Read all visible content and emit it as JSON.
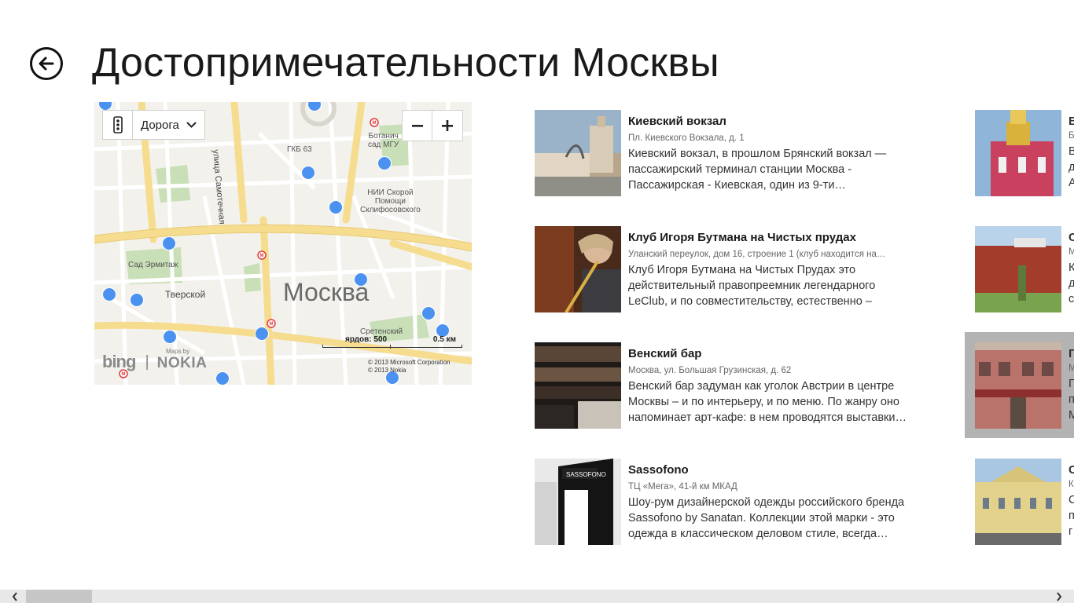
{
  "page": {
    "title": "Достопримечательности Москвы"
  },
  "map": {
    "style_label": "Дорога",
    "city_label": "Москва",
    "labels": {
      "samotechnaya": "улица Самотечная",
      "gkb": "ГКБ 63",
      "botanic": "Ботанич\nсад МГУ",
      "nii": "НИИ Скорой\nПомощи\nСклифосовского",
      "hermitage": "Сад Эрмитаж",
      "tverskoy": "Тверской",
      "sretensky": "Сретенский"
    },
    "scale": {
      "yards": "ярдов: 500",
      "km": "0.5 км"
    },
    "logo": {
      "maps_by": "Maps by",
      "bing": "bing",
      "nokia": "NOKIA"
    },
    "copyright": [
      "© 2013 Microsoft Corporation",
      "© 2013 Nokia"
    ]
  },
  "items": [
    {
      "name": "Киевский вокзал",
      "address": "Пл. Киевского Вокзала, д. 1",
      "description": "Киевский вокзал, в прошлом Брянский вокзал — пассажирский терминал станции Москва - Пассажирская - Киевская, один из 9-ти…"
    },
    {
      "name": "Клуб Игоря Бутмана на Чистых прудах",
      "address": "Уланский переулок, дом 16, строение 1 (клуб находится на…",
      "description": "Клуб Игоря Бутмана на Чистых Прудах это действительный правопреемник легендарного LeClub, и по совместительству, естественно – джазовый…"
    },
    {
      "name": "Венский бар",
      "address": "Москва, ул. Большая Грузинская, д. 62",
      "description": "Венский бар задуман как уголок Австрии в центре Москвы – и по интерьеру, и по меню. По жанру оно напоминает арт-кафе: в нем проводятся выставки…"
    },
    {
      "name": "Sassofono",
      "address": "ТЦ «Мега», 41-й км МКАД",
      "description": "Шоу-рум дизайнерской одежды российского бренда Sassofono by Sanatan. Коллекции этой марки - это одежда в классическом деловом стиле, всегда…"
    }
  ],
  "col2": [
    {
      "name": "Б",
      "sub": "Б",
      "lines": [
        "В",
        "д",
        "А"
      ]
    },
    {
      "name": "С",
      "sub": "М",
      "lines": [
        "К",
        "д",
        "с"
      ]
    },
    {
      "name": "Г",
      "sub": "М",
      "lines": [
        "П",
        "п",
        "М"
      ]
    },
    {
      "name": "С",
      "sub": "К",
      "lines": [
        "С",
        "п",
        "г"
      ]
    }
  ],
  "colors": {
    "pin": "#4b92f0",
    "highlight": "#b3b3b3",
    "scrollbar": "#e8e8e8"
  }
}
